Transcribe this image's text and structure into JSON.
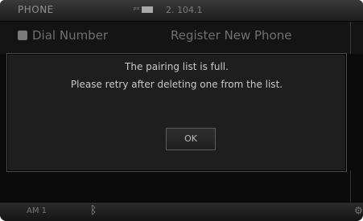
{
  "header": {
    "title": "PHONE",
    "clock": "2. 104.1"
  },
  "menu": {
    "items": [
      {
        "label": "Dial Number",
        "icon": "dial-pad-icon"
      },
      {
        "label": "Register New Phone"
      }
    ]
  },
  "dialog": {
    "line1": "The pairing list is full.",
    "line2": "Please retry after deleting one from the list.",
    "ok_label": "OK"
  },
  "footer": {
    "label": "AM 1",
    "bluetooth_icon": "bluetooth-icon",
    "settings_icon": "settings-icon"
  }
}
